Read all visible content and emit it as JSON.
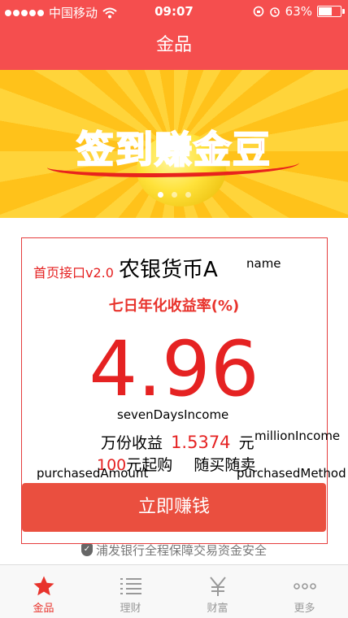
{
  "status": {
    "carrier": "中国移动",
    "time": "09:07",
    "battery": "63%",
    "battery_level": 0.63
  },
  "nav": {
    "title": "金品"
  },
  "banner": {
    "text": "签到赚金豆",
    "page_count": 3,
    "active_page": 1
  },
  "card": {
    "api_label": "首页接口v2.0",
    "fund_name": "农银货币A",
    "name_field": "name",
    "rate_title": "七日年化收益率(%)",
    "rate_value": "4.96",
    "seven_days_field": "sevenDaysIncome",
    "million_label": "万份收益",
    "million_value": "1.5374",
    "million_unit": "元",
    "million_field": "millionIncome",
    "purchase_amount": "100",
    "purchase_unit": "元起购",
    "purchase_method": "随买随卖",
    "amount_field": "purchasedAmount",
    "method_field": "purchasedMethod",
    "button_label": "立即赚钱"
  },
  "security_text": "浦发银行全程保障交易资金安全",
  "tabs": [
    {
      "label": "金品",
      "icon": "star-icon",
      "active": true
    },
    {
      "label": "理财",
      "icon": "list-icon",
      "active": false
    },
    {
      "label": "财富",
      "icon": "yen-icon",
      "active": false
    },
    {
      "label": "更多",
      "icon": "more-icon",
      "active": false
    }
  ],
  "colors": {
    "brand_red": "#f54e4e",
    "accent_red": "#e52222",
    "button_red": "#ea4f3f"
  }
}
